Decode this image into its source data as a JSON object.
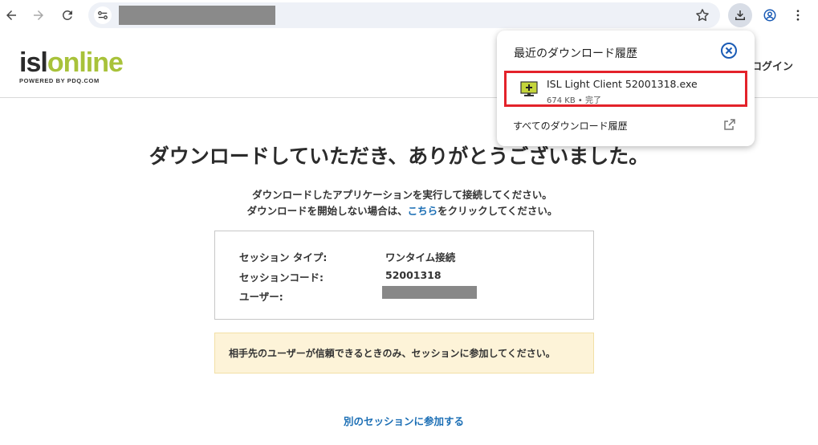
{
  "browser": {
    "url_redacted": true,
    "icons": [
      "back-icon",
      "forward-icon",
      "reload-icon",
      "site-info-icon",
      "star-icon",
      "download-icon",
      "profile-icon",
      "menu-icon"
    ]
  },
  "site": {
    "logo_part1": "isl",
    "logo_part2": "online",
    "logo_sub": "POWERED BY PDQ.COM",
    "login_label": "ログイン"
  },
  "main": {
    "heading": "ダウンロードしていただき、ありがとうございました。",
    "desc_line1": "ダウンロードしたアプリケーションを実行して接続してください。",
    "desc_line2_before": "ダウンロードを開始しない場合は、",
    "desc_link": "こちら",
    "desc_line2_after": "をクリックしてください。",
    "session": {
      "type_label": "セッション タイプ:",
      "type_value": "ワンタイム接続",
      "code_label": "セッションコード:",
      "code_value": "52001318",
      "user_label": "ユーザー:"
    },
    "warning": "相手先のユーザーが信頼できるときのみ、セッションに参加してください。",
    "other_session_link": "別のセッションに参加する"
  },
  "downloads_popup": {
    "title": "最近のダウンロード履歴",
    "item": {
      "file_name": "ISL Light Client 52001318.exe",
      "meta": "674 KB • 完了"
    },
    "all_downloads_label": "すべてのダウンロード履歴"
  },
  "colors": {
    "accent_blue": "#1c6fb5",
    "logo_green": "#a8c23a",
    "highlight_red": "#e3222a",
    "warning_bg": "#fdf3d8"
  }
}
